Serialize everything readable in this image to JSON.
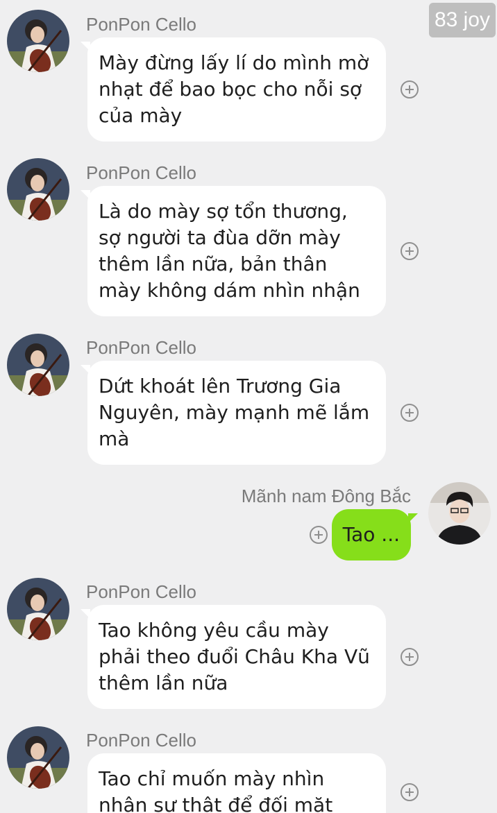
{
  "watermark": "83 joy",
  "messages": [
    {
      "sender": "PonPon Cello",
      "direction": "incoming",
      "avatar_icon": "cello-player-avatar",
      "text": "Mày đừng lấy lí do mình mờ nhạt để bao bọc cho nỗi sợ của mày"
    },
    {
      "sender": "PonPon Cello",
      "direction": "incoming",
      "avatar_icon": "cello-player-avatar",
      "text": "Là do mày sợ tổn thương, sợ người ta đùa dỡn mày thêm lần nữa, bản thân mày không dám nhìn nhận"
    },
    {
      "sender": "PonPon Cello",
      "direction": "incoming",
      "avatar_icon": "cello-player-avatar",
      "text": "Dứt khoát lên Trương Gia Nguyên, mày mạnh mẽ lắm mà"
    },
    {
      "sender": "Mãnh nam Đông Bắc",
      "direction": "outgoing",
      "avatar_icon": "boy-avatar",
      "text": "Tao ..."
    },
    {
      "sender": "PonPon Cello",
      "direction": "incoming",
      "avatar_icon": "cello-player-avatar",
      "text": "Tao không yêu cầu mày phải theo đuổi Châu Kha Vũ thêm lần nữa"
    },
    {
      "sender": "PonPon Cello",
      "direction": "incoming",
      "avatar_icon": "cello-player-avatar",
      "text": "Tao chỉ muốn mày nhìn nhận sự thật để đối mặt"
    }
  ],
  "colors": {
    "background": "#efeff0",
    "incoming_bubble": "#ffffff",
    "outgoing_bubble": "#86de1a",
    "name_text": "#7a7a7a"
  }
}
